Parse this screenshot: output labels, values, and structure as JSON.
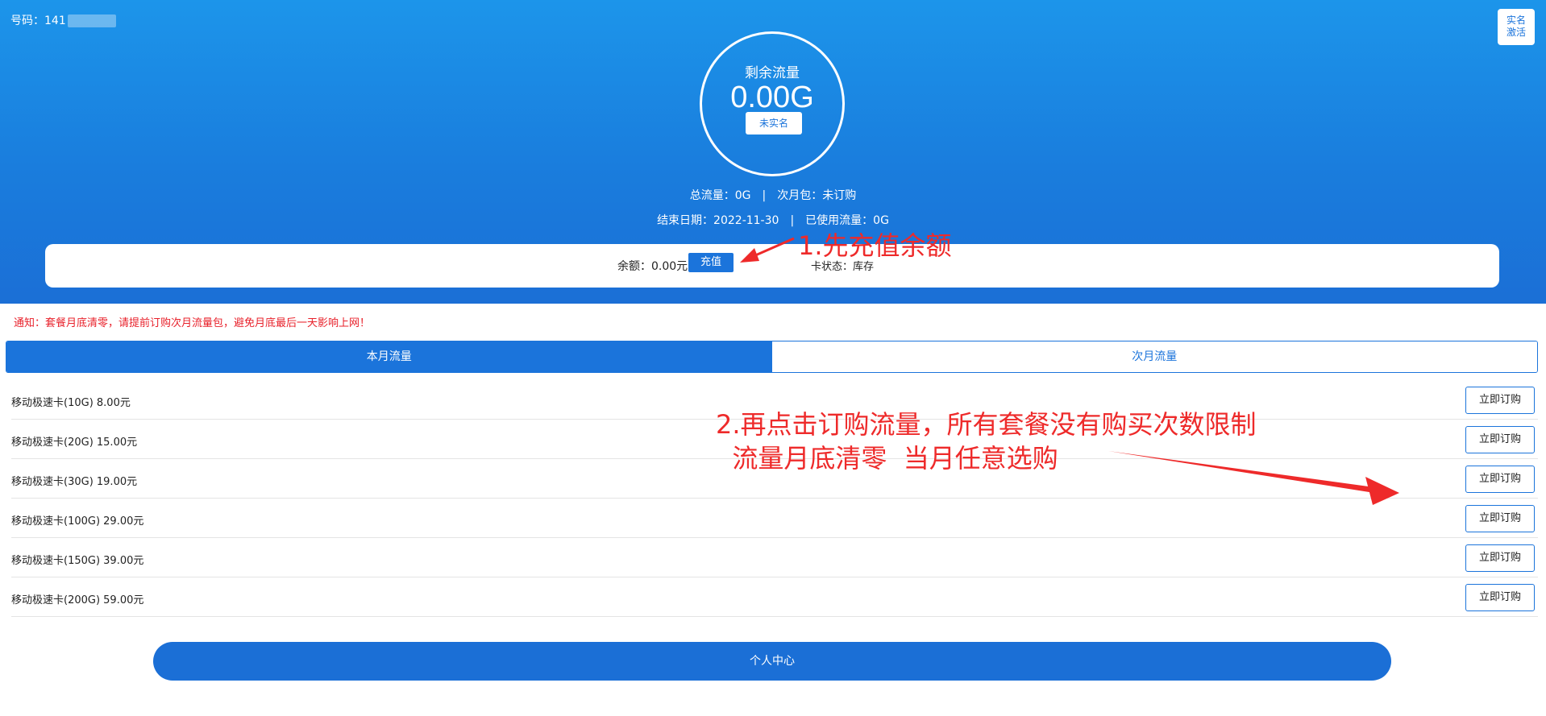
{
  "header": {
    "phone_label": "号码：141",
    "realname_btn_line1": "实名",
    "realname_btn_line2": "激活",
    "remaining_label": "剩余流量",
    "remaining_value": "0.00G",
    "status_btn": "未实名",
    "total_flow": "总流量：0G",
    "next_month_pkg": "次月包：未订购",
    "end_date": "结束日期：2022-11-30",
    "used_flow": "已使用流量：0G",
    "separator": "|"
  },
  "balance": {
    "label": "余额：0.00元",
    "recharge_btn": "充值",
    "card_status": "卡状态：库存"
  },
  "annotations": {
    "step1": "1.先充值余额",
    "step2_line1": "2.再点击订购流量，所有套餐没有购买次数限制",
    "step2_line2": "  流量月底清零  当月任意选购",
    "color": "#ee2a2a"
  },
  "notice": "通知：套餐月底清零，请提前订购次月流量包，避免月底最后一天影响上网！",
  "tabs": [
    {
      "label": "本月流量",
      "active": true
    },
    {
      "label": "次月流量",
      "active": false
    }
  ],
  "products": [
    {
      "name": "移动极速卡(10G) 8.00元",
      "button": "立即订购"
    },
    {
      "name": "移动极速卡(20G) 15.00元",
      "button": "立即订购"
    },
    {
      "name": "移动极速卡(30G) 19.00元",
      "button": "立即订购"
    },
    {
      "name": "移动极速卡(100G) 29.00元",
      "button": "立即订购"
    },
    {
      "name": "移动极速卡(150G) 39.00元",
      "button": "立即订购"
    },
    {
      "name": "移动极速卡(200G) 59.00元",
      "button": "立即订购"
    }
  ],
  "footer": {
    "center_btn": "个人中心"
  },
  "colors": {
    "primary": "#1b74db",
    "header_top": "#1c95ea",
    "notice": "#e8202a"
  }
}
